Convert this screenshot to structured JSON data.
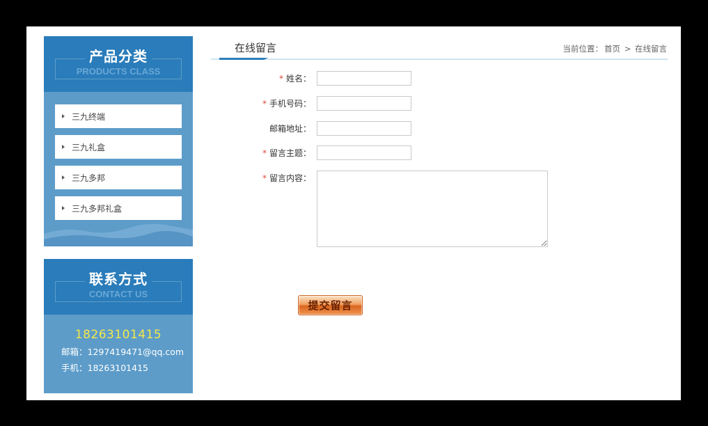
{
  "sidebar": {
    "categories": {
      "title_zh": "产品分类",
      "title_en": "PRODUCTS CLASS",
      "items": [
        {
          "label": "三九终端"
        },
        {
          "label": "三九礼盒"
        },
        {
          "label": "三九多邦"
        },
        {
          "label": "三九多邦礼盒"
        }
      ]
    },
    "contact": {
      "title_zh": "联系方式",
      "title_en": "CONTACT US",
      "phone_big": "18263101415",
      "email_label": "邮箱：",
      "email": "1297419471@qq.com",
      "mobile_label": "手机：",
      "mobile": "18263101415"
    }
  },
  "main": {
    "tab_title": "在线留言",
    "breadcrumb": {
      "prefix": "当前位置：",
      "home": "首页",
      "separator": ">",
      "current": "在线留言"
    },
    "form": {
      "required_mark": "*",
      "fields": [
        {
          "label": "姓名：",
          "value": ""
        },
        {
          "label": "手机号码：",
          "value": ""
        },
        {
          "label": "邮箱地址：",
          "value": ""
        },
        {
          "label": "留言主题：",
          "value": ""
        },
        {
          "label": "留言内容：",
          "value": ""
        }
      ],
      "submit_label": "提交留言"
    }
  },
  "colors": {
    "sidebar_head": "#2a7cba",
    "sidebar_body": "#5d9cc9",
    "phone_highlight": "#f4e84a",
    "required": "#e0483c"
  }
}
